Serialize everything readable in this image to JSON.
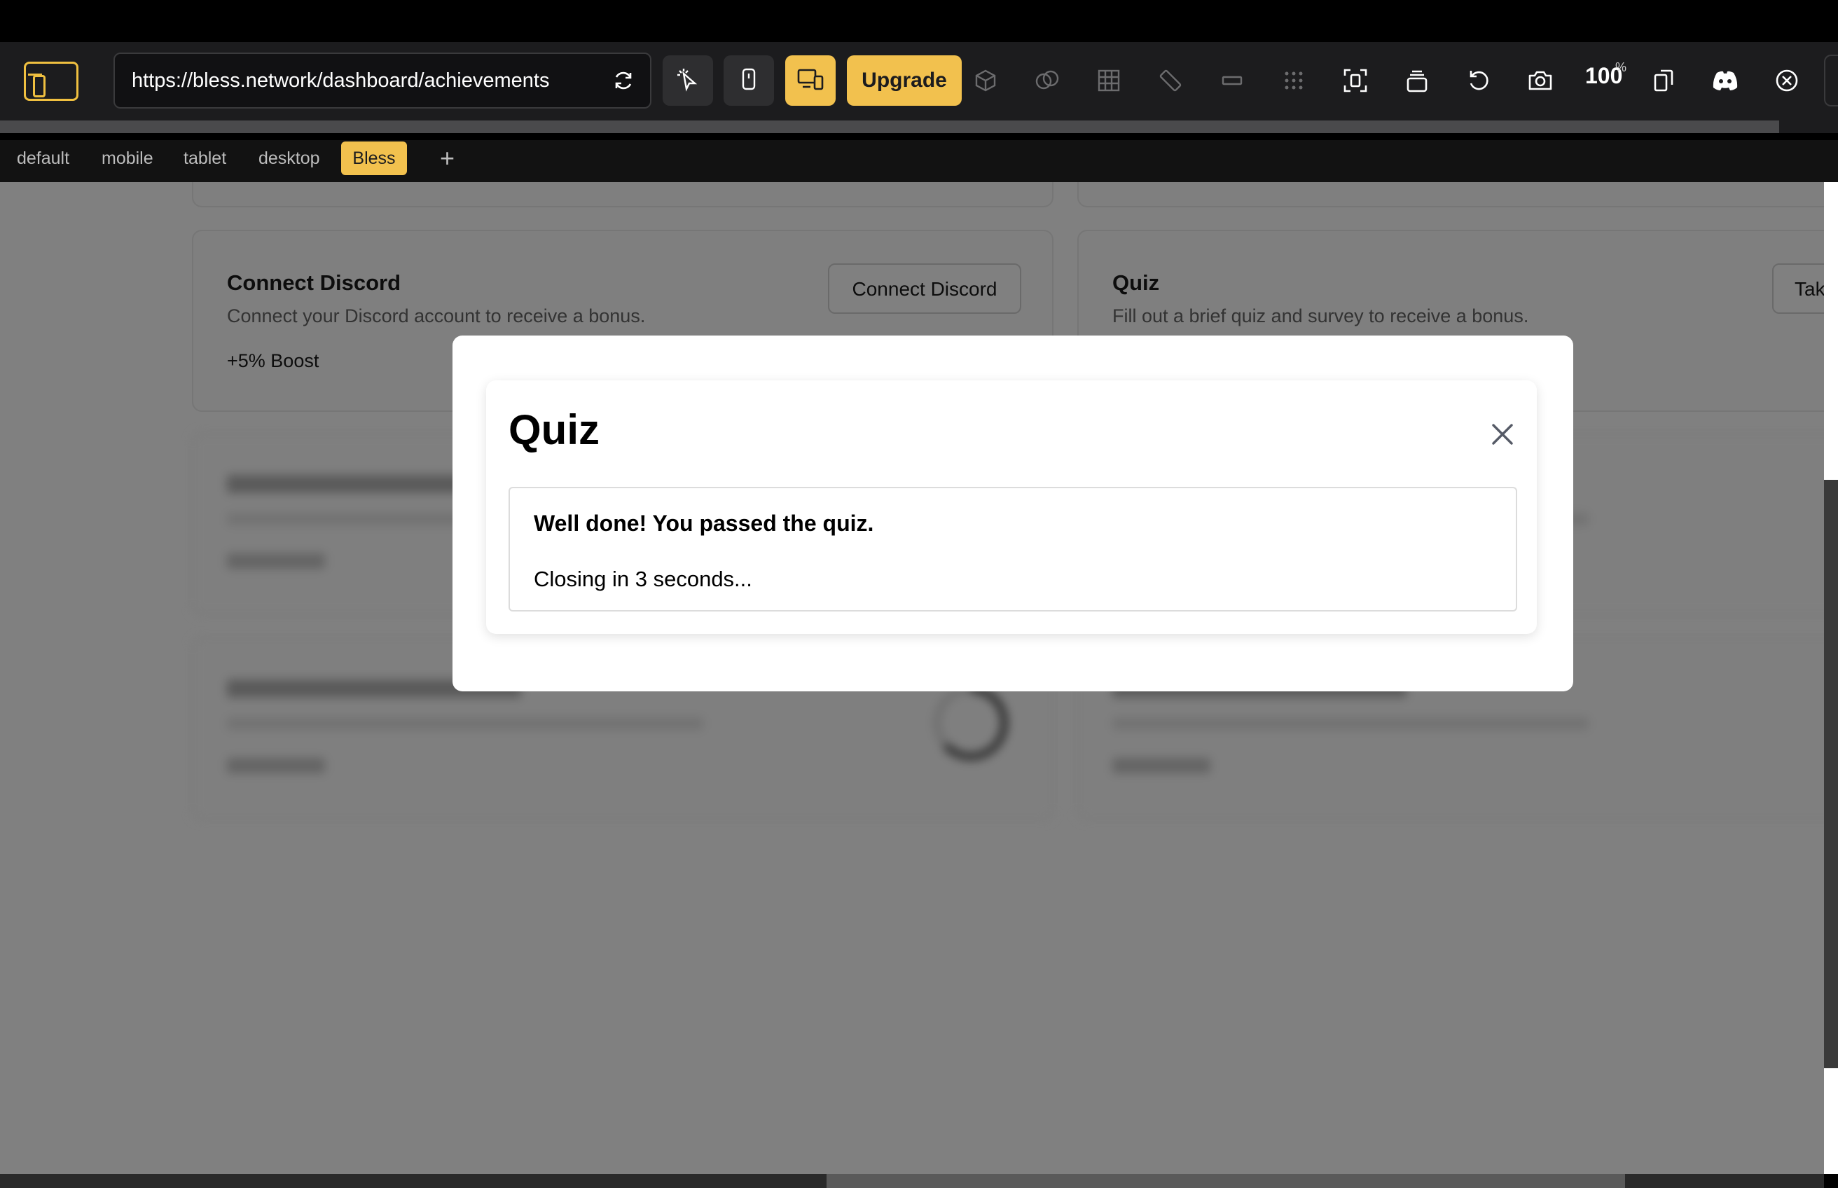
{
  "browser": {
    "url": "https://bless.network/dashboard/achievements",
    "upgrade_label": "Upgrade",
    "zoom_value": "100",
    "zoom_unit": "%"
  },
  "device_tabs": {
    "items": [
      "default",
      "mobile",
      "tablet",
      "desktop"
    ],
    "active": "Bless",
    "add_label": "+"
  },
  "page": {
    "cards": {
      "discord": {
        "title": "Connect Discord",
        "description": "Connect your Discord account to receive a bonus.",
        "boost": "+5% Boost",
        "button": "Connect Discord"
      },
      "quiz": {
        "title": "Quiz",
        "description": "Fill out a brief quiz and survey to receive a bonus.",
        "button": "Tak"
      }
    }
  },
  "modal": {
    "title": "Quiz",
    "result_title": "Well done! You passed the quiz.",
    "result_subtitle": "Closing in 3 seconds..."
  },
  "colors": {
    "accent": "#f2c14e",
    "toolbar_bg": "#1c1c1e",
    "overlay_bg": "#808080"
  }
}
